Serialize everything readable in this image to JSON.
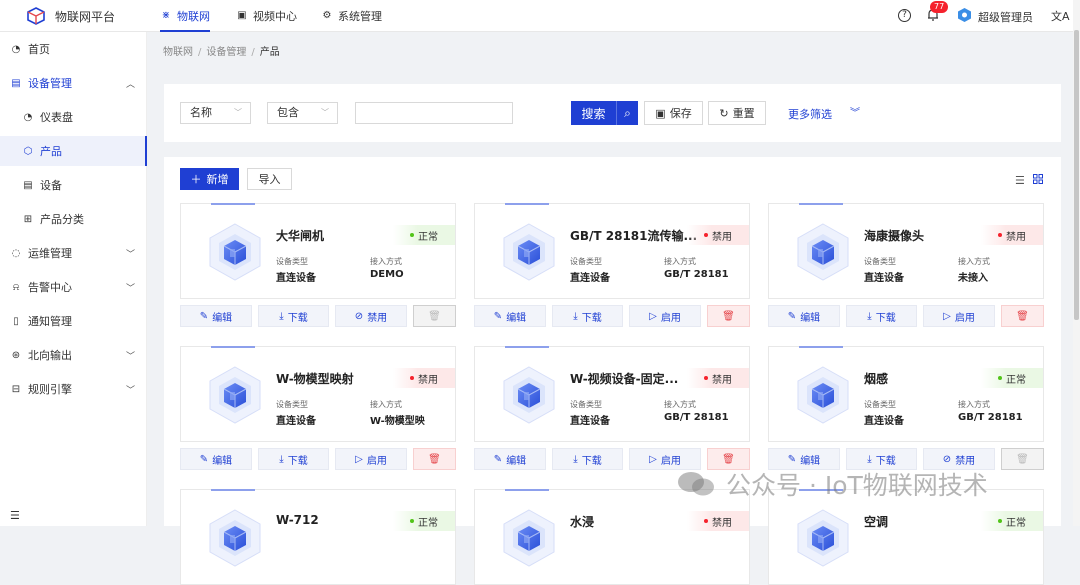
{
  "app": {
    "title": "物联网平台"
  },
  "topnav": {
    "tabs": [
      {
        "label": "物联网",
        "icon": "iot-icon",
        "active": true
      },
      {
        "label": "视频中心",
        "icon": "video-icon",
        "active": false
      },
      {
        "label": "系统管理",
        "icon": "settings-icon",
        "active": false
      }
    ],
    "notifications": "77",
    "user": "超级管理员",
    "language_icon": "translate-icon"
  },
  "sidebar": {
    "items": [
      {
        "label": "首页",
        "icon": "home-icon"
      },
      {
        "label": "设备管理",
        "icon": "device-manage-icon"
      },
      {
        "label": "仪表盘",
        "icon": "dashboard-icon"
      },
      {
        "label": "产品",
        "icon": "product-icon"
      },
      {
        "label": "设备",
        "icon": "device-icon"
      },
      {
        "label": "产品分类",
        "icon": "category-icon"
      },
      {
        "label": "运维管理",
        "icon": "ops-icon"
      },
      {
        "label": "告警中心",
        "icon": "alarm-icon"
      },
      {
        "label": "通知管理",
        "icon": "notice-icon"
      },
      {
        "label": "北向输出",
        "icon": "output-icon"
      },
      {
        "label": "规则引擎",
        "icon": "rule-icon"
      }
    ]
  },
  "breadcrumb": [
    "物联网",
    "设备管理",
    "产品"
  ],
  "filter": {
    "field": "名称",
    "op": "包含",
    "value": "",
    "search": "搜索",
    "save": "保存",
    "reset": "重置",
    "more": "更多筛选"
  },
  "toolbar": {
    "add": "新增",
    "import": "导入"
  },
  "labels": {
    "type": "设备类型",
    "access": "接入方式",
    "edit": "编辑",
    "download": "下载",
    "disable": "禁用",
    "enable": "启用"
  },
  "colors": {
    "primary": "#1f3fd3",
    "ok": "#52c41a",
    "off": "#f5222d"
  },
  "cards": [
    {
      "name": "大华闸机",
      "status": "正常",
      "type": "直连设备",
      "access": "DEMO",
      "toggle": "禁用"
    },
    {
      "name": "GB/T 28181流传输...",
      "status": "禁用",
      "type": "直连设备",
      "access": "GB/T 28181",
      "toggle": "启用"
    },
    {
      "name": "海康摄像头",
      "status": "禁用",
      "type": "直连设备",
      "access": "未接入",
      "toggle": "启用"
    },
    {
      "name": "W-物模型映射",
      "status": "禁用",
      "type": "直连设备",
      "access": "W-物模型映",
      "toggle": "启用"
    },
    {
      "name": "W-视频设备-固定...",
      "status": "禁用",
      "type": "直连设备",
      "access": "GB/T 28181",
      "toggle": "启用"
    },
    {
      "name": "烟感",
      "status": "正常",
      "type": "直连设备",
      "access": "GB/T 28181",
      "toggle": "禁用"
    },
    {
      "name": "W-712",
      "status": "正常"
    },
    {
      "name": "水浸",
      "status": "禁用"
    },
    {
      "name": "空调",
      "status": "正常"
    }
  ],
  "watermark": "公众号 · IoT物联网技术"
}
